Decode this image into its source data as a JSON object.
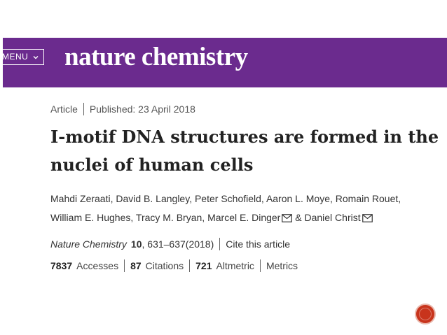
{
  "header": {
    "menu_label": "MENU",
    "logo_text": "nature chemistry",
    "bar_color": "#6b2b8e"
  },
  "article": {
    "type": "Article",
    "published": "Published: 23 April 2018",
    "title_line1": "I-motif DNA structures are formed in the",
    "title_line2": "nuclei of human cells",
    "authors": [
      "Mahdi Zeraati",
      "David B. Langley",
      "Peter Schofield",
      "Aaron L. Moye",
      "Romain Rouet",
      "William E. Hughes",
      "Tracy M. Bryan",
      "Marcel E. Dinger",
      "Daniel Christ"
    ],
    "author_joiner": "&"
  },
  "citation": {
    "journal": "Nature Chemistry",
    "volume": "10",
    "pages_year": ", 631–637(2018)",
    "cite_link": "Cite this article"
  },
  "metrics": {
    "accesses_count": "7837",
    "accesses_label": "Accesses",
    "citations_count": "87",
    "citations_label": "Citations",
    "altmetric_count": "721",
    "altmetric_label": "Altmetric",
    "metrics_link": "Metrics"
  },
  "icons": {
    "menu_chevron": "chevron-down-icon",
    "mail": "mail-icon",
    "nav": "next-slide-icon"
  },
  "colors": {
    "nav_button": "#c8341c"
  }
}
